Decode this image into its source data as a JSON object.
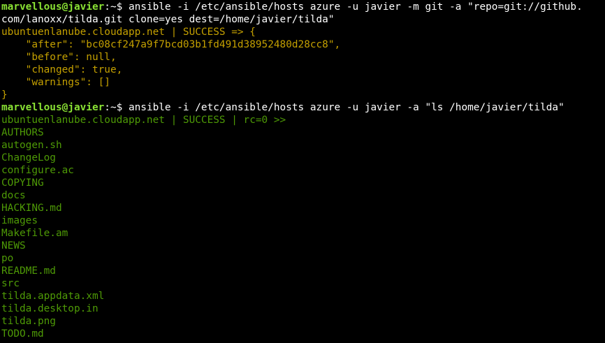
{
  "colors": {
    "background": "#000000",
    "prompt_user": "#8ae234",
    "command_text": "#ffffff",
    "changed_output": "#c4a000",
    "success_output": "#4e9a06"
  },
  "terminal": {
    "prompt": {
      "user_host": "marvellous@javier",
      "suffix": ":~$ "
    },
    "command1": {
      "line1": "ansible -i /etc/ansible/hosts azure -u javier -m git -a \"repo=git://github.",
      "line2": "com/lanoxx/tilda.git clone=yes dest=/home/javier/tilda\""
    },
    "output1": [
      "ubuntuenlanube.cloudapp.net | SUCCESS => {",
      "    \"after\": \"bc08cf247a9f7bcd03b1fd491d38952480d28cc8\",",
      "    \"before\": null,",
      "    \"changed\": true,",
      "    \"warnings\": []",
      "}"
    ],
    "command2": "ansible -i /etc/ansible/hosts azure -u javier -a \"ls /home/javier/tilda\"",
    "output2_header": "ubuntuenlanube.cloudapp.net | SUCCESS | rc=0 >>",
    "file_list": [
      "AUTHORS",
      "autogen.sh",
      "ChangeLog",
      "configure.ac",
      "COPYING",
      "docs",
      "HACKING.md",
      "images",
      "Makefile.am",
      "NEWS",
      "po",
      "README.md",
      "src",
      "tilda.appdata.xml",
      "tilda.desktop.in",
      "tilda.png",
      "TODO.md"
    ]
  }
}
